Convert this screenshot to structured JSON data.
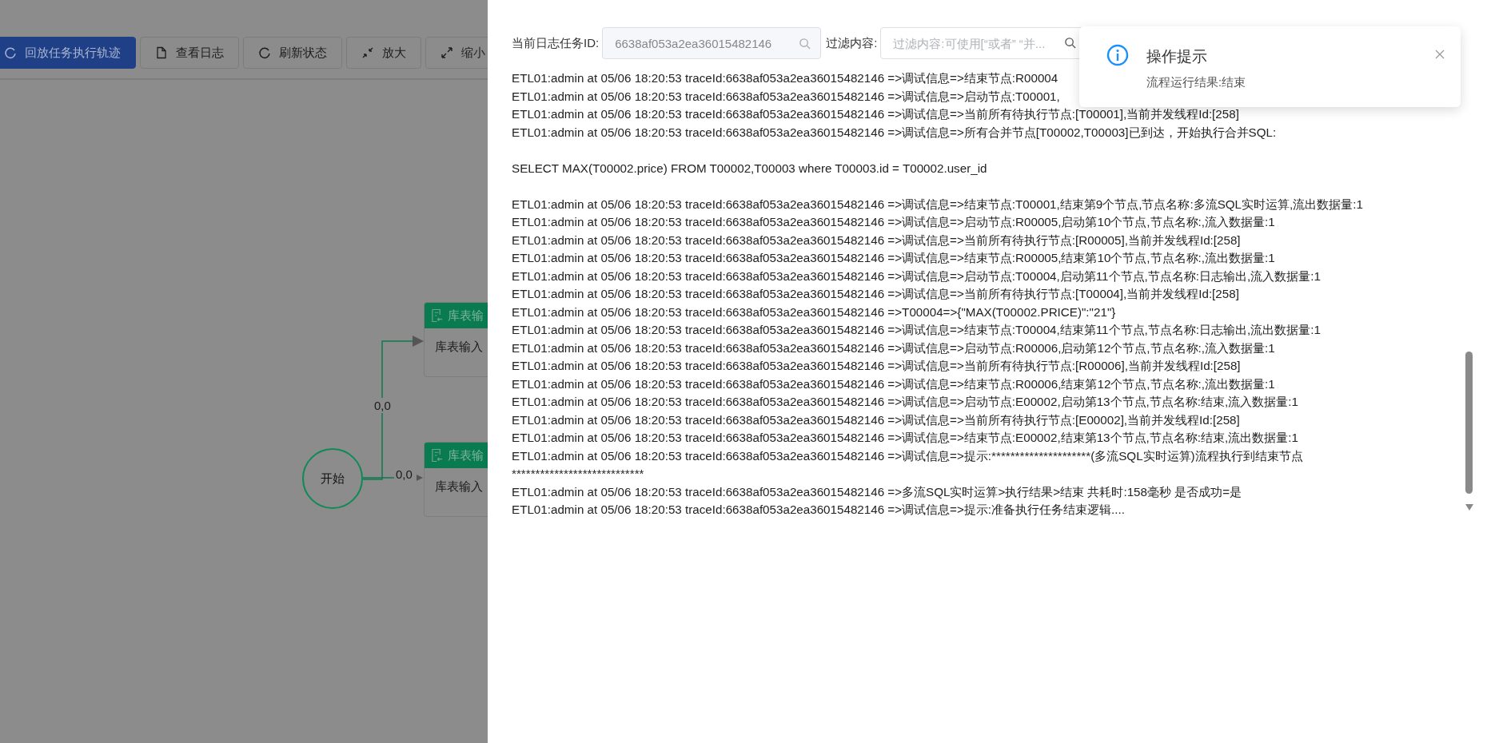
{
  "toolbar": {
    "buttons": [
      {
        "label": "回放任务执行轨迹",
        "kind": "refresh",
        "primary": true
      },
      {
        "label": "查看日志",
        "kind": "file",
        "primary": false
      },
      {
        "label": "刷新状态",
        "kind": "refresh",
        "primary": false
      },
      {
        "label": "放大",
        "kind": "shrink",
        "primary": false
      },
      {
        "label": "缩小",
        "kind": "expand",
        "primary": false
      }
    ]
  },
  "canvas": {
    "start_node": {
      "label": "开始"
    },
    "edges": [
      {
        "label": "0,0"
      },
      {
        "label": "0,0"
      }
    ],
    "nodes": [
      {
        "header": "库表输",
        "body": "库表输入"
      },
      {
        "header": "库表输",
        "body": "库表输入"
      }
    ]
  },
  "log_panel": {
    "task_id_label": "当前日志任务ID:",
    "task_id_value": "6638af053a2ea36015482146",
    "filter_label": "过滤内容:",
    "filter_placeholder": "过滤内容:可使用[“或者” “并...",
    "blocks": [
      [
        "ETL01:admin at 05/06 18:20:53 traceId:6638af053a2ea36015482146 =>调试信息=>结束节点:R00004",
        "ETL01:admin at 05/06 18:20:53 traceId:6638af053a2ea36015482146 =>调试信息=>启动节点:T00001,",
        "ETL01:admin at 05/06 18:20:53 traceId:6638af053a2ea36015482146 =>调试信息=>当前所有待执行节点:[T00001],当前并发线程Id:[258]",
        "ETL01:admin at 05/06 18:20:53 traceId:6638af053a2ea36015482146 =>调试信息=>所有合并节点[T00002,T00003]已到达，开始执行合并SQL:"
      ],
      [
        "SELECT MAX(T00002.price) FROM T00002,T00003 where T00003.id = T00002.user_id"
      ],
      [
        "ETL01:admin at 05/06 18:20:53 traceId:6638af053a2ea36015482146 =>调试信息=>结束节点:T00001,结束第9个节点,节点名称:多流SQL实时运算,流出数据量:1",
        "ETL01:admin at 05/06 18:20:53 traceId:6638af053a2ea36015482146 =>调试信息=>启动节点:R00005,启动第10个节点,节点名称:,流入数据量:1",
        "ETL01:admin at 05/06 18:20:53 traceId:6638af053a2ea36015482146 =>调试信息=>当前所有待执行节点:[R00005],当前并发线程Id:[258]",
        "ETL01:admin at 05/06 18:20:53 traceId:6638af053a2ea36015482146 =>调试信息=>结束节点:R00005,结束第10个节点,节点名称:,流出数据量:1",
        "ETL01:admin at 05/06 18:20:53 traceId:6638af053a2ea36015482146 =>调试信息=>启动节点:T00004,启动第11个节点,节点名称:日志输出,流入数据量:1",
        "ETL01:admin at 05/06 18:20:53 traceId:6638af053a2ea36015482146 =>调试信息=>当前所有待执行节点:[T00004],当前并发线程Id:[258]",
        "ETL01:admin at 05/06 18:20:53 traceId:6638af053a2ea36015482146 =>T00004=>{\"MAX(T00002.PRICE)\":\"21\"}",
        "ETL01:admin at 05/06 18:20:53 traceId:6638af053a2ea36015482146 =>调试信息=>结束节点:T00004,结束第11个节点,节点名称:日志输出,流出数据量:1",
        "ETL01:admin at 05/06 18:20:53 traceId:6638af053a2ea36015482146 =>调试信息=>启动节点:R00006,启动第12个节点,节点名称:,流入数据量:1",
        "ETL01:admin at 05/06 18:20:53 traceId:6638af053a2ea36015482146 =>调试信息=>当前所有待执行节点:[R00006],当前并发线程Id:[258]",
        "ETL01:admin at 05/06 18:20:53 traceId:6638af053a2ea36015482146 =>调试信息=>结束节点:R00006,结束第12个节点,节点名称:,流出数据量:1",
        "ETL01:admin at 05/06 18:20:53 traceId:6638af053a2ea36015482146 =>调试信息=>启动节点:E00002,启动第13个节点,节点名称:结束,流入数据量:1",
        "ETL01:admin at 05/06 18:20:53 traceId:6638af053a2ea36015482146 =>调试信息=>当前所有待执行节点:[E00002],当前并发线程Id:[258]",
        "ETL01:admin at 05/06 18:20:53 traceId:6638af053a2ea36015482146 =>调试信息=>结束节点:E00002,结束第13个节点,节点名称:结束,流出数据量:1",
        "ETL01:admin at 05/06 18:20:53 traceId:6638af053a2ea36015482146 =>调试信息=>提示:*********************(多流SQL实时运算)流程执行到结束节点",
        "****************************",
        "ETL01:admin at 05/06 18:20:53 traceId:6638af053a2ea36015482146 =>多流SQL实时运算>执行结果>结束 共耗时:158毫秒 是否成功=是",
        "ETL01:admin at 05/06 18:20:53 traceId:6638af053a2ea36015482146 =>调试信息=>提示:准备执行任务结束逻辑...."
      ]
    ]
  },
  "notification": {
    "title": "操作提示",
    "message": "流程运行结果:结束"
  }
}
